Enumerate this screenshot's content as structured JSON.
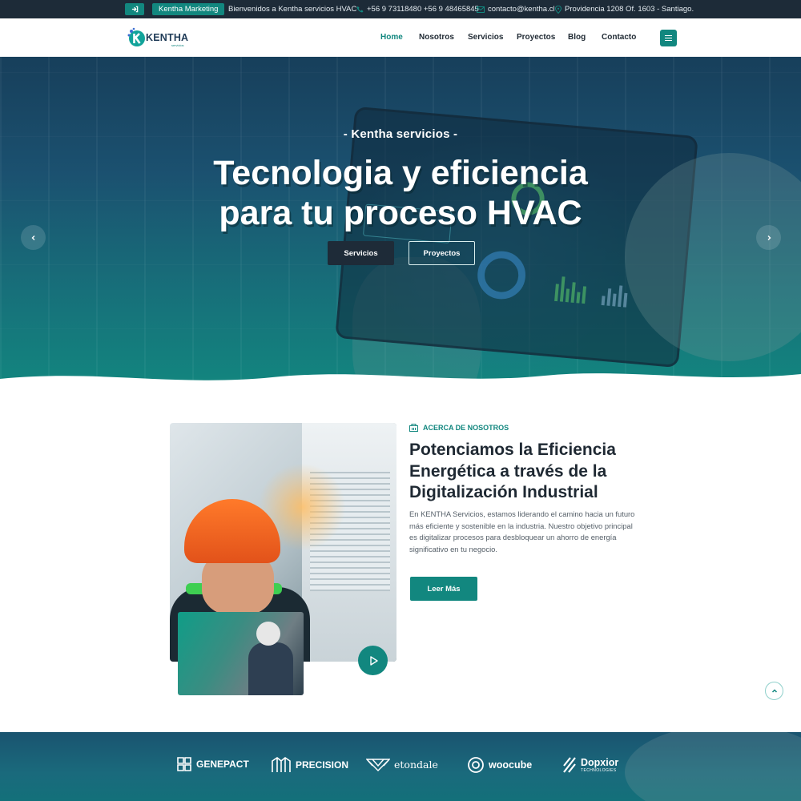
{
  "topbar": {
    "marketing_label": "Kentha Marketing",
    "welcome_text": "Bienvenidos a Kentha servicios HVAC",
    "phone": "+56 9 73118480 +56 9 48465845",
    "email": "contacto@kentha.cl",
    "address": "Providencia 1208 Of. 1603 - Santiago."
  },
  "header": {
    "logo_text": "KENTHA",
    "logo_sub": "servicios",
    "nav": [
      "Home",
      "Nosotros",
      "Servicios",
      "Proyectos",
      "Blog",
      "Contacto"
    ],
    "active_nav": "Home"
  },
  "hero": {
    "subtitle": "- Kentha servicios -",
    "title_line1": "Tecnologia y eficiencia",
    "title_line2": "para tu proceso HVAC",
    "btn_primary": "Servicios",
    "btn_secondary": "Proyectos"
  },
  "about": {
    "tag": "ACERCA DE NOSOTROS",
    "title_line1": "Potenciamos la Eficiencia",
    "title_line2": "Energética a través de la",
    "title_line3": "Digitalización Industrial",
    "text": "En KENTHA Servicios, estamos liderando el camino hacia un futuro más eficiente y sostenible en la industria. Nuestro objetivo principal es digitalizar procesos para desbloquear un ahorro de energía significativo en tu negocio.",
    "button": "Leer Más"
  },
  "partners": [
    {
      "name": "GENEPACT",
      "sub": ""
    },
    {
      "name": "PRECISION",
      "sub": ""
    },
    {
      "name": "etondale",
      "sub": ""
    },
    {
      "name": "woocube",
      "sub": ""
    },
    {
      "name": "Dopxior",
      "sub": "TECHNOLOGIES"
    }
  ],
  "colors": {
    "brand": "#12877f",
    "topbar": "#1d2b38",
    "dark_button": "#1e2b38",
    "heading": "#1f2933"
  },
  "icons": [
    "login-icon",
    "phone-icon",
    "mail-icon",
    "location-icon",
    "menu-icon",
    "chevron-left-icon",
    "chevron-right-icon",
    "building-icon",
    "play-icon",
    "chevron-up-icon"
  ]
}
